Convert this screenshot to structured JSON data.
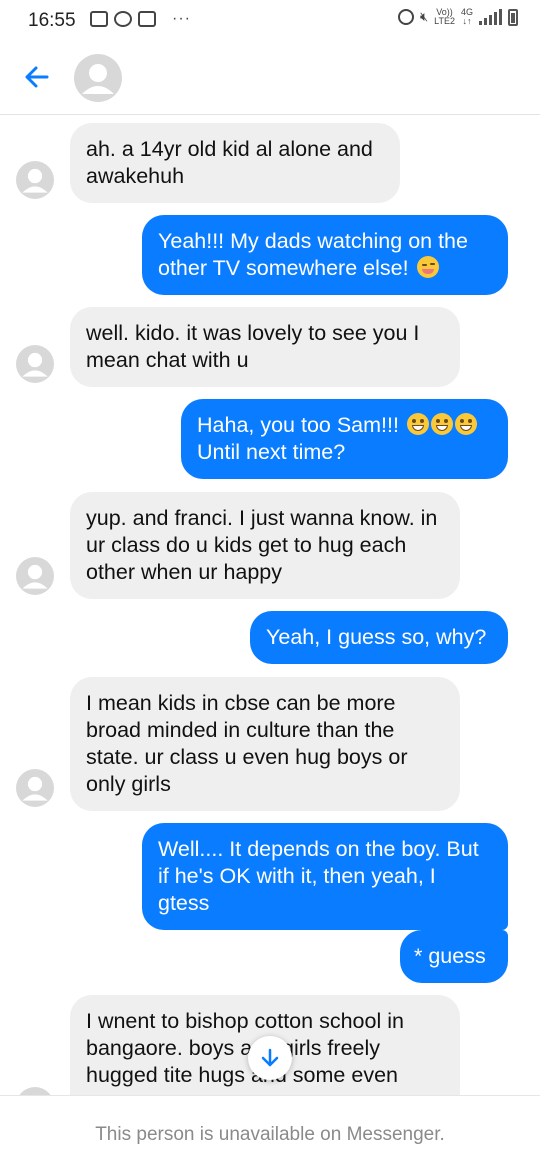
{
  "status_bar": {
    "time": "16:55",
    "network_label_top": "Vo))",
    "network_label_bottom": "LTE2",
    "data_type": "4G",
    "more": "···"
  },
  "header": {
    "back_icon": "arrow-left-icon",
    "avatar_icon": "default-avatar-icon"
  },
  "messages": [
    {
      "sender": "them",
      "text": "ah. a 14yr old kid al alone and awakehuh"
    },
    {
      "sender": "me",
      "text": "Yeah!!! My dads watching on the other TV somewhere else! ",
      "emoji": "winking-face"
    },
    {
      "sender": "them",
      "text": "well. kido. it was lovely to see you I mean chat with u"
    },
    {
      "sender": "me",
      "text_line1": "Haha, you too Sam!!! ",
      "text_line2": "Until next time?",
      "emoji": "grinning-face x3"
    },
    {
      "sender": "them",
      "text": "yup. and franci. I just wanna know. in ur class do u kids get to hug each other when ur happy"
    },
    {
      "sender": "me",
      "text": "Yeah, I guess so, why?"
    },
    {
      "sender": "them",
      "text": "I mean kids in cbse can be more broad minded in culture than the state. ur class u even hug boys or only girls"
    },
    {
      "sender": "me",
      "text": "Well.... It depends on the boy. But if he's OK with it, then yeah, I gtess"
    },
    {
      "sender": "me",
      "text": "* guess"
    },
    {
      "sender": "them",
      "text": "I wnent to bishop cotton school in bangaore. boys and girls freely hugged tite hugs and some even"
    }
  ],
  "footer": {
    "notice": "This person is unavailable on Messenger."
  },
  "colors": {
    "outgoing_bubble": "#0a7cff",
    "incoming_bubble": "#efefef",
    "accent": "#0a7cff"
  }
}
